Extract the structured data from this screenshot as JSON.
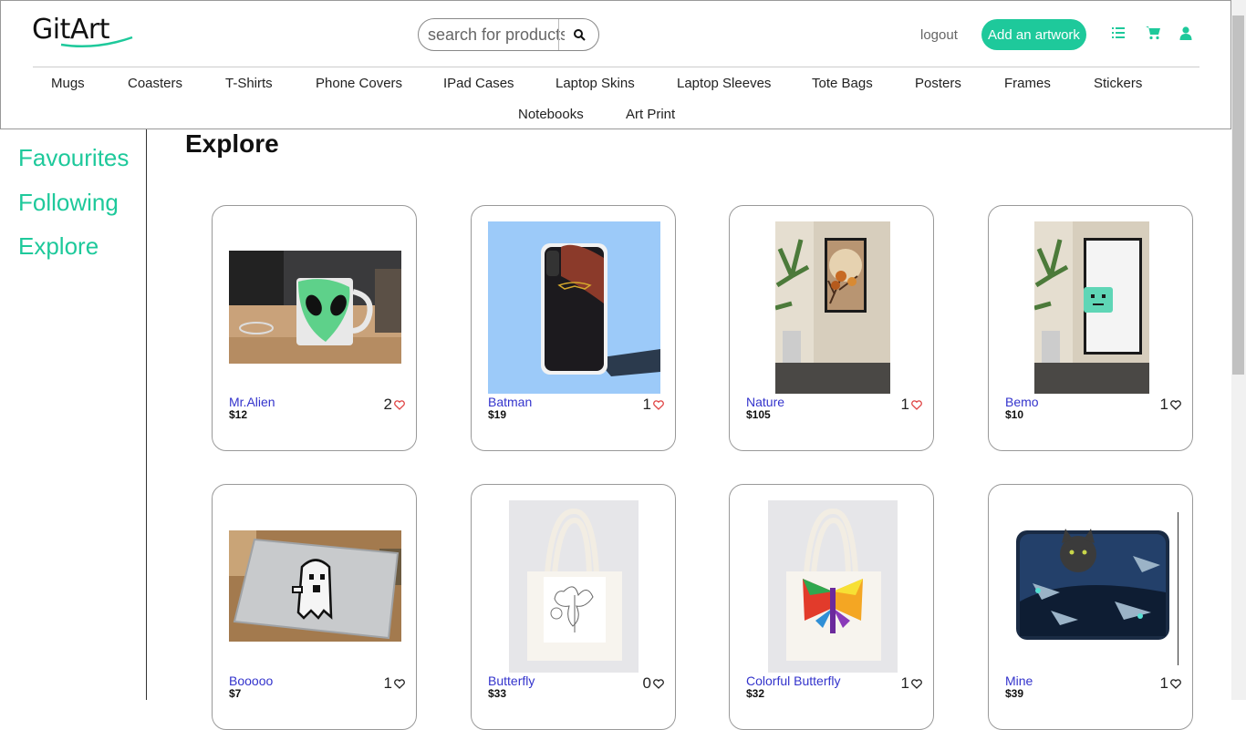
{
  "header": {
    "logo": "GitArt",
    "search_placeholder": "search for products",
    "logout_label": "logout",
    "add_artwork_label": "Add an artwork",
    "icons": [
      "list-icon",
      "cart-icon",
      "user-icon"
    ],
    "accent_color": "#1ec99b"
  },
  "categories": [
    "Mugs",
    "Coasters",
    "T-Shirts",
    "Phone Covers",
    "IPad Cases",
    "Laptop Skins",
    "Laptop Sleeves",
    "Tote Bags",
    "Posters",
    "Frames",
    "Stickers",
    "Notebooks",
    "Art Print"
  ],
  "sidebar": {
    "items": [
      {
        "label": "Favourites"
      },
      {
        "label": "Following"
      },
      {
        "label": "Explore"
      }
    ]
  },
  "main": {
    "title": "Explore",
    "products": [
      {
        "name": "Mr.Alien",
        "price": "$12",
        "likes": "2",
        "liked": true
      },
      {
        "name": "Batman",
        "price": "$19",
        "likes": "1",
        "liked": true
      },
      {
        "name": "Nature",
        "price": "$105",
        "likes": "1",
        "liked": true
      },
      {
        "name": "Bemo",
        "price": "$10",
        "likes": "1",
        "liked": false
      },
      {
        "name": "Booooo",
        "price": "$7",
        "likes": "1",
        "liked": false
      },
      {
        "name": "Butterfly",
        "price": "$33",
        "likes": "0",
        "liked": false
      },
      {
        "name": "Colorful Butterfly",
        "price": "$32",
        "likes": "1",
        "liked": false
      },
      {
        "name": "Mine",
        "price": "$39",
        "likes": "1",
        "liked": false
      }
    ]
  }
}
